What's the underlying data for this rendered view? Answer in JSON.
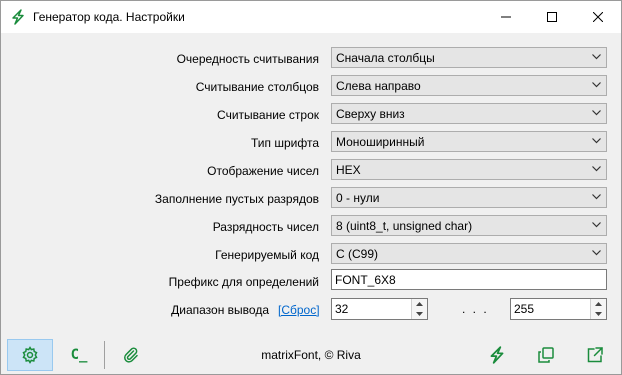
{
  "window": {
    "title": "Генератор кода.  Настройки",
    "icon": "bolt-icon",
    "accent": "#1a8c3c"
  },
  "settings": {
    "read_order": {
      "label": "Очередность считывания",
      "value": "Сначала столбцы"
    },
    "columns_read": {
      "label": "Считывание столбцов",
      "value": "Слева направо"
    },
    "rows_read": {
      "label": "Считывание строк",
      "value": "Сверху вниз"
    },
    "font_type": {
      "label": "Тип шрифта",
      "value": "Моноширинный"
    },
    "number_display": {
      "label": "Отображение чисел",
      "value": "HEX"
    },
    "empty_fill": {
      "label": "Заполнение пустых разрядов",
      "value": "0 - нули"
    },
    "number_width": {
      "label": "Разрядность чисел",
      "value": "8 (uint8_t, unsigned char)"
    },
    "generated_code": {
      "label": "Генерируемый код",
      "value": "C (C99)"
    },
    "prefix": {
      "label": "Префикс для определений",
      "value": "FONT_6X8"
    },
    "range": {
      "label": "Диапазон вывода",
      "reset_label": "[Сброс]",
      "from": "32",
      "separator": ". . .",
      "to": "255"
    }
  },
  "bottom": {
    "credit": "matrixFont, © Riva",
    "code_button_label": "C_"
  }
}
